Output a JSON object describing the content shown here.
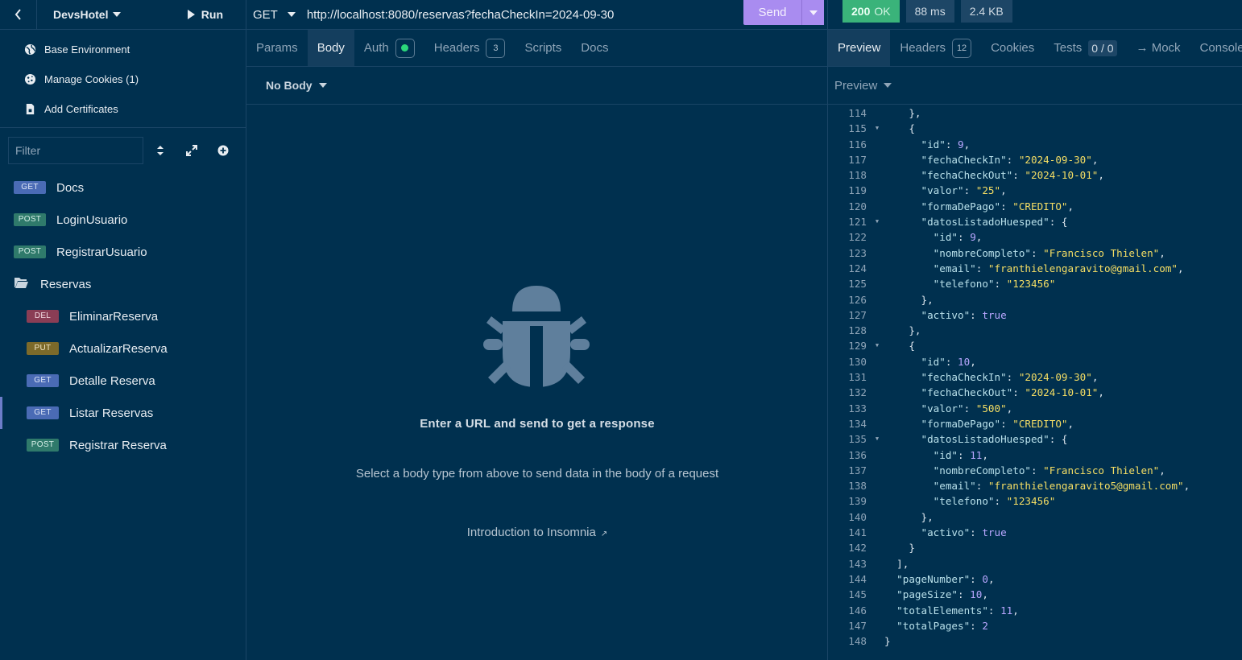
{
  "sidebar": {
    "workspace": "DevsHotel",
    "run_label": "Run",
    "env_items": [
      {
        "label": "Base Environment",
        "icon": "globe-icon"
      },
      {
        "label": "Manage Cookies (1)",
        "icon": "cookie-icon"
      },
      {
        "label": "Add Certificates",
        "icon": "certificate-icon"
      }
    ],
    "filter_placeholder": "Filter",
    "requests": [
      {
        "method": "GET",
        "name": "Docs"
      },
      {
        "method": "POST",
        "name": "LoginUsuario"
      },
      {
        "method": "POST",
        "name": "RegistrarUsuario"
      }
    ],
    "folder": {
      "name": "Reservas",
      "children": [
        {
          "method": "DEL",
          "name": "EliminarReserva"
        },
        {
          "method": "PUT",
          "name": "ActualizarReserva"
        },
        {
          "method": "GET",
          "name": "Detalle Reserva"
        },
        {
          "method": "GET",
          "name": "Listar Reservas"
        },
        {
          "method": "POST",
          "name": "Registrar Reserva"
        }
      ]
    }
  },
  "request": {
    "method": "GET",
    "url": "http://localhost:8080/reservas?fechaCheckIn=2024-09-30",
    "send_label": "Send",
    "tabs": {
      "params": "Params",
      "body": "Body",
      "auth": "Auth",
      "headers": "Headers",
      "headers_count": "3",
      "scripts": "Scripts",
      "docs": "Docs"
    },
    "body_type": "No Body",
    "empty_title": "Enter a URL and send to get a response",
    "empty_subtitle": "Select a body type from above to send data in the body of a request",
    "intro_link": "Introduction to Insomnia"
  },
  "response": {
    "status_code": "200",
    "status_text": "OK",
    "time": "88 ms",
    "size": "2.4 KB",
    "tabs": {
      "preview": "Preview",
      "headers": "Headers",
      "headers_count": "12",
      "cookies": "Cookies",
      "tests": "Tests",
      "tests_count": "0 / 0",
      "mock": "→ Mock",
      "console": "Console"
    },
    "preview_mode": "Preview",
    "lines": [
      {
        "n": "114",
        "text": "    },"
      },
      {
        "n": "115",
        "text": "    {"
      },
      {
        "n": "116",
        "text": "      \"id\": 9,"
      },
      {
        "n": "117",
        "text": "      \"fechaCheckIn\": \"2024-09-30\","
      },
      {
        "n": "118",
        "text": "      \"fechaCheckOut\": \"2024-10-01\","
      },
      {
        "n": "119",
        "text": "      \"valor\": \"25\","
      },
      {
        "n": "120",
        "text": "      \"formaDePago\": \"CREDITO\","
      },
      {
        "n": "121",
        "text": "      \"datosListadoHuesped\": {"
      },
      {
        "n": "122",
        "text": "        \"id\": 9,"
      },
      {
        "n": "123",
        "text": "        \"nombreCompleto\": \"Francisco Thielen\","
      },
      {
        "n": "124",
        "text": "        \"email\": \"franthielengaravito@gmail.com\","
      },
      {
        "n": "125",
        "text": "        \"telefono\": \"123456\""
      },
      {
        "n": "126",
        "text": "      },"
      },
      {
        "n": "127",
        "text": "      \"activo\": true"
      },
      {
        "n": "128",
        "text": "    },"
      },
      {
        "n": "129",
        "text": "    {"
      },
      {
        "n": "130",
        "text": "      \"id\": 10,"
      },
      {
        "n": "131",
        "text": "      \"fechaCheckIn\": \"2024-09-30\","
      },
      {
        "n": "132",
        "text": "      \"fechaCheckOut\": \"2024-10-01\","
      },
      {
        "n": "133",
        "text": "      \"valor\": \"500\","
      },
      {
        "n": "134",
        "text": "      \"formaDePago\": \"CREDITO\","
      },
      {
        "n": "135",
        "text": "      \"datosListadoHuesped\": {"
      },
      {
        "n": "136",
        "text": "        \"id\": 11,"
      },
      {
        "n": "137",
        "text": "        \"nombreCompleto\": \"Francisco Thielen\","
      },
      {
        "n": "138",
        "text": "        \"email\": \"franthielengaravito5@gmail.com\","
      },
      {
        "n": "139",
        "text": "        \"telefono\": \"123456\""
      },
      {
        "n": "140",
        "text": "      },"
      },
      {
        "n": "141",
        "text": "      \"activo\": true"
      },
      {
        "n": "142",
        "text": "    }"
      },
      {
        "n": "143",
        "text": "  ],"
      },
      {
        "n": "144",
        "text": "  \"pageNumber\": 0,"
      },
      {
        "n": "145",
        "text": "  \"pageSize\": 10,"
      },
      {
        "n": "146",
        "text": "  \"totalElements\": 11,"
      },
      {
        "n": "147",
        "text": "  \"totalPages\": 2"
      },
      {
        "n": "148",
        "text": "}"
      }
    ],
    "foldable_lines": [
      "115",
      "121",
      "129",
      "135"
    ]
  },
  "colors": {
    "background": "#00304f",
    "send": "#a98cf0",
    "status_ok": "#3ab37a",
    "method_get": "#4a6bb5",
    "method_post": "#2f7a6b",
    "method_del": "#8a3d55",
    "method_put": "#7c6a2a"
  }
}
